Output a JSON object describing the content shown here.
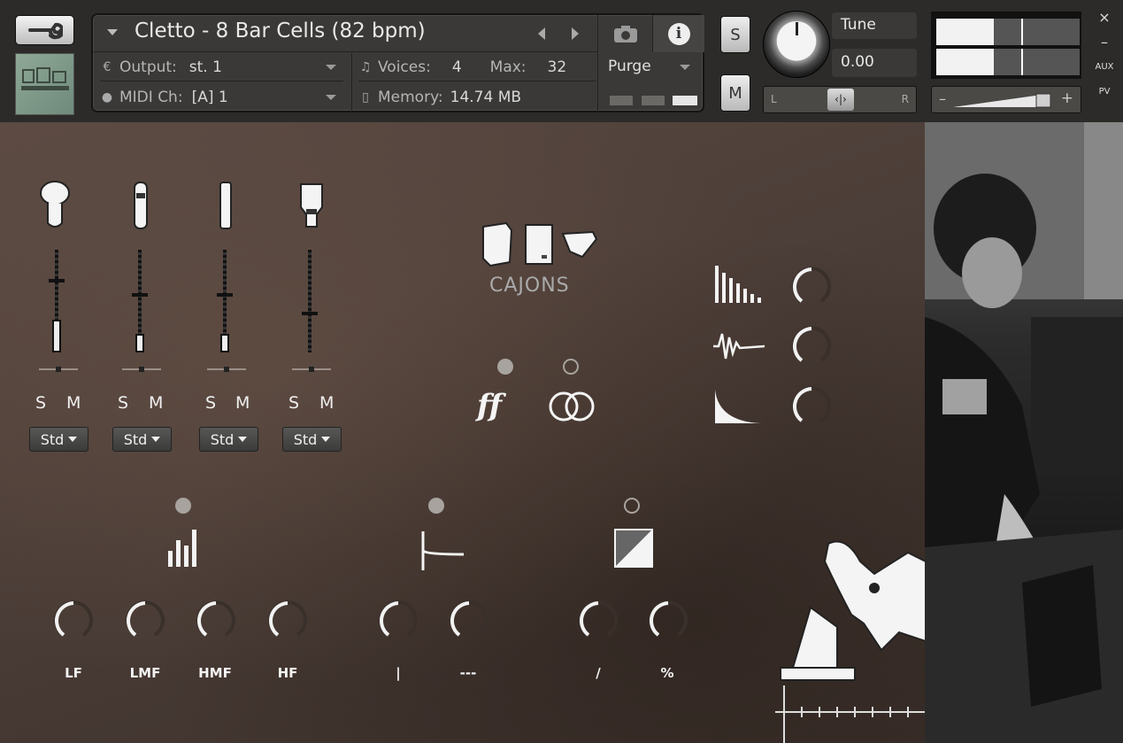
{
  "header": {
    "instrument_title": "Cletto - 8 Bar Cells (82 bpm)",
    "output_label": "Output:",
    "output_value": "st. 1",
    "midi_label": "MIDI Ch:",
    "midi_value": "[A]  1",
    "voices_label": "Voices:",
    "voices_value": "4",
    "max_label": "Max:",
    "max_value": "32",
    "memory_label": "Memory:",
    "memory_value": "14.74 MB",
    "purge_label": "Purge",
    "solo_label": "S",
    "mute_label": "M",
    "tune_label": "Tune",
    "tune_value": "0.00",
    "pan_left": "L",
    "pan_right": "R",
    "aux_label": "AUX",
    "pv_label": "PV",
    "close_glyph": "×",
    "minimize_glyph": "–",
    "vol_minus": "–",
    "vol_plus": "+",
    "level_meter": [
      0.4,
      0.4
    ]
  },
  "mixer": {
    "channels": [
      {
        "solo": "S",
        "mute": "M",
        "mode": "Std",
        "fader_level": 0.32
      },
      {
        "solo": "S",
        "mute": "M",
        "mode": "Std",
        "fader_level": 0.18
      },
      {
        "solo": "S",
        "mute": "M",
        "mode": "Std",
        "fader_level": 0.18
      },
      {
        "solo": "S",
        "mute": "M",
        "mode": "Std",
        "fader_level": 0.0
      }
    ]
  },
  "center": {
    "logo_text": "CAJONS",
    "ff_label": "ff"
  },
  "eq": {
    "labels": [
      "LF",
      "LMF",
      "HMF",
      "HF"
    ]
  },
  "reverb": {
    "labels": [
      "|",
      "---"
    ]
  },
  "comp": {
    "labels": [
      "/",
      "%"
    ]
  },
  "colors": {
    "panel_bg": "#4b3d37",
    "header_bg": "#2c2b29",
    "led_on": "#a8a39f"
  }
}
